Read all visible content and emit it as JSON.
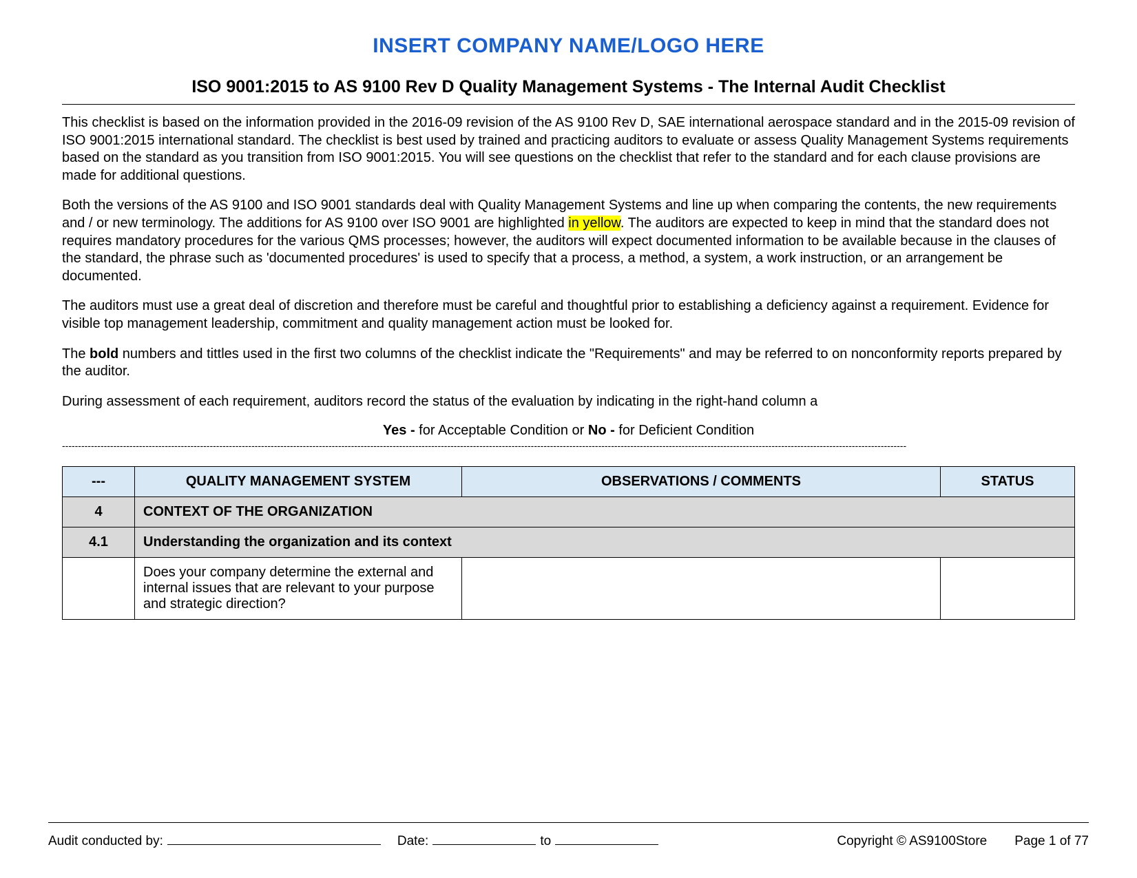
{
  "header": {
    "placeholder": "INSERT COMPANY NAME/LOGO HERE",
    "title": "ISO 9001:2015 to AS 9100 Rev D  Quality Management Systems - The Internal Audit Checklist"
  },
  "intro": {
    "p1": "This checklist is based on the information provided in the 2016-09 revision of the AS 9100 Rev D, SAE international aerospace standard and in the 2015-09 revision of ISO 9001:2015 international standard. The checklist is best used by trained and practicing auditors to evaluate or assess Quality Management Systems requirements based on the standard as you transition from ISO 9001:2015. You will see questions on the checklist that refer to the standard and for each clause provisions are made for additional questions.",
    "p2a": "Both the versions of the AS 9100 and ISO 9001 standards deal with Quality Management Systems and line up when comparing the contents, the new requirements and / or new terminology. The additions for AS 9100 over ISO 9001 are highlighted ",
    "p2_highlight": "in yellow",
    "p2b": ". The auditors are expected to keep in mind that the standard does not requires mandatory procedures for the various QMS processes; however, the auditors will expect documented information to be available because in the clauses of the standard, the phrase such as 'documented procedures' is used to specify that a process, a method, a system, a work instruction, or an arrangement be documented.",
    "p3": "The auditors must use a great deal of discretion and therefore must be careful and thoughtful prior to establishing a deficiency against a requirement.  Evidence for visible top management leadership, commitment and quality management action must be looked for.",
    "p4a": "The ",
    "p4_bold": "bold",
    "p4b": " numbers and tittles used in the first two columns of the checklist indicate the \"Requirements\" and may be referred to on nonconformity reports prepared by the auditor.",
    "p5": "During assessment of each requirement, auditors record the status of the evaluation by indicating in the right-hand column a",
    "legend_yes_label": "Yes - ",
    "legend_yes_text": "for Acceptable Condition or ",
    "legend_no_label": "No - ",
    "legend_no_text": "for Deficient Condition"
  },
  "table": {
    "headers": {
      "num": "---",
      "qms": "QUALITY MANAGEMENT SYSTEM",
      "obs": "OBSERVATIONS / COMMENTS",
      "status": "STATUS"
    },
    "rows": [
      {
        "type": "section",
        "num": "4",
        "title": "CONTEXT OF THE ORGANIZATION"
      },
      {
        "type": "section",
        "num": "4.1",
        "title": "Understanding the organization and its context"
      },
      {
        "type": "item",
        "num": "",
        "question": "Does your company determine the external and internal issues that are relevant to your purpose and strategic direction?",
        "obs": "",
        "status": ""
      }
    ]
  },
  "footer": {
    "audit_by_label": "Audit conducted by:",
    "date_label": "Date:",
    "to_label": "to",
    "copyright": "Copyright © AS9100Store",
    "page": "Page 1 of 77"
  }
}
